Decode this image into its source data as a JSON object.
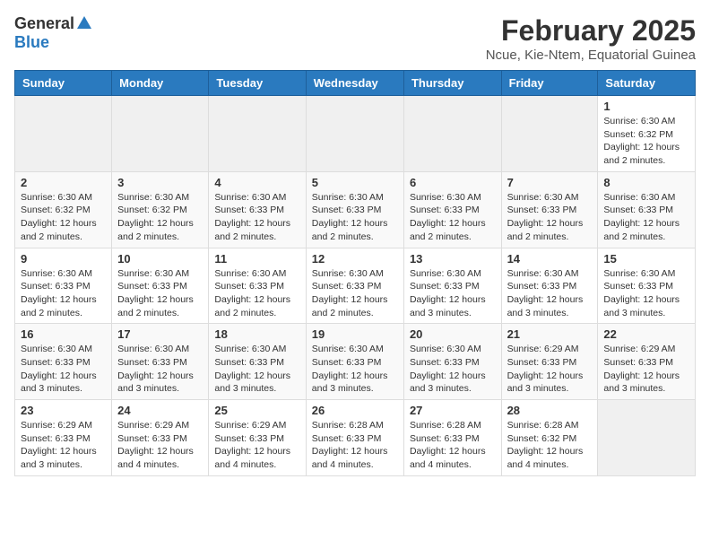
{
  "logo": {
    "general": "General",
    "blue": "Blue"
  },
  "title": {
    "month": "February 2025",
    "location": "Ncue, Kie-Ntem, Equatorial Guinea"
  },
  "days_of_week": [
    "Sunday",
    "Monday",
    "Tuesday",
    "Wednesday",
    "Thursday",
    "Friday",
    "Saturday"
  ],
  "weeks": [
    [
      {
        "day": "",
        "detail": ""
      },
      {
        "day": "",
        "detail": ""
      },
      {
        "day": "",
        "detail": ""
      },
      {
        "day": "",
        "detail": ""
      },
      {
        "day": "",
        "detail": ""
      },
      {
        "day": "",
        "detail": ""
      },
      {
        "day": "1",
        "detail": "Sunrise: 6:30 AM\nSunset: 6:32 PM\nDaylight: 12 hours and 2 minutes."
      }
    ],
    [
      {
        "day": "2",
        "detail": "Sunrise: 6:30 AM\nSunset: 6:32 PM\nDaylight: 12 hours and 2 minutes."
      },
      {
        "day": "3",
        "detail": "Sunrise: 6:30 AM\nSunset: 6:32 PM\nDaylight: 12 hours and 2 minutes."
      },
      {
        "day": "4",
        "detail": "Sunrise: 6:30 AM\nSunset: 6:33 PM\nDaylight: 12 hours and 2 minutes."
      },
      {
        "day": "5",
        "detail": "Sunrise: 6:30 AM\nSunset: 6:33 PM\nDaylight: 12 hours and 2 minutes."
      },
      {
        "day": "6",
        "detail": "Sunrise: 6:30 AM\nSunset: 6:33 PM\nDaylight: 12 hours and 2 minutes."
      },
      {
        "day": "7",
        "detail": "Sunrise: 6:30 AM\nSunset: 6:33 PM\nDaylight: 12 hours and 2 minutes."
      },
      {
        "day": "8",
        "detail": "Sunrise: 6:30 AM\nSunset: 6:33 PM\nDaylight: 12 hours and 2 minutes."
      }
    ],
    [
      {
        "day": "9",
        "detail": "Sunrise: 6:30 AM\nSunset: 6:33 PM\nDaylight: 12 hours and 2 minutes."
      },
      {
        "day": "10",
        "detail": "Sunrise: 6:30 AM\nSunset: 6:33 PM\nDaylight: 12 hours and 2 minutes."
      },
      {
        "day": "11",
        "detail": "Sunrise: 6:30 AM\nSunset: 6:33 PM\nDaylight: 12 hours and 2 minutes."
      },
      {
        "day": "12",
        "detail": "Sunrise: 6:30 AM\nSunset: 6:33 PM\nDaylight: 12 hours and 2 minutes."
      },
      {
        "day": "13",
        "detail": "Sunrise: 6:30 AM\nSunset: 6:33 PM\nDaylight: 12 hours and 3 minutes."
      },
      {
        "day": "14",
        "detail": "Sunrise: 6:30 AM\nSunset: 6:33 PM\nDaylight: 12 hours and 3 minutes."
      },
      {
        "day": "15",
        "detail": "Sunrise: 6:30 AM\nSunset: 6:33 PM\nDaylight: 12 hours and 3 minutes."
      }
    ],
    [
      {
        "day": "16",
        "detail": "Sunrise: 6:30 AM\nSunset: 6:33 PM\nDaylight: 12 hours and 3 minutes."
      },
      {
        "day": "17",
        "detail": "Sunrise: 6:30 AM\nSunset: 6:33 PM\nDaylight: 12 hours and 3 minutes."
      },
      {
        "day": "18",
        "detail": "Sunrise: 6:30 AM\nSunset: 6:33 PM\nDaylight: 12 hours and 3 minutes."
      },
      {
        "day": "19",
        "detail": "Sunrise: 6:30 AM\nSunset: 6:33 PM\nDaylight: 12 hours and 3 minutes."
      },
      {
        "day": "20",
        "detail": "Sunrise: 6:30 AM\nSunset: 6:33 PM\nDaylight: 12 hours and 3 minutes."
      },
      {
        "day": "21",
        "detail": "Sunrise: 6:29 AM\nSunset: 6:33 PM\nDaylight: 12 hours and 3 minutes."
      },
      {
        "day": "22",
        "detail": "Sunrise: 6:29 AM\nSunset: 6:33 PM\nDaylight: 12 hours and 3 minutes."
      }
    ],
    [
      {
        "day": "23",
        "detail": "Sunrise: 6:29 AM\nSunset: 6:33 PM\nDaylight: 12 hours and 3 minutes."
      },
      {
        "day": "24",
        "detail": "Sunrise: 6:29 AM\nSunset: 6:33 PM\nDaylight: 12 hours and 4 minutes."
      },
      {
        "day": "25",
        "detail": "Sunrise: 6:29 AM\nSunset: 6:33 PM\nDaylight: 12 hours and 4 minutes."
      },
      {
        "day": "26",
        "detail": "Sunrise: 6:28 AM\nSunset: 6:33 PM\nDaylight: 12 hours and 4 minutes."
      },
      {
        "day": "27",
        "detail": "Sunrise: 6:28 AM\nSunset: 6:33 PM\nDaylight: 12 hours and 4 minutes."
      },
      {
        "day": "28",
        "detail": "Sunrise: 6:28 AM\nSunset: 6:32 PM\nDaylight: 12 hours and 4 minutes."
      },
      {
        "day": "",
        "detail": ""
      }
    ]
  ]
}
